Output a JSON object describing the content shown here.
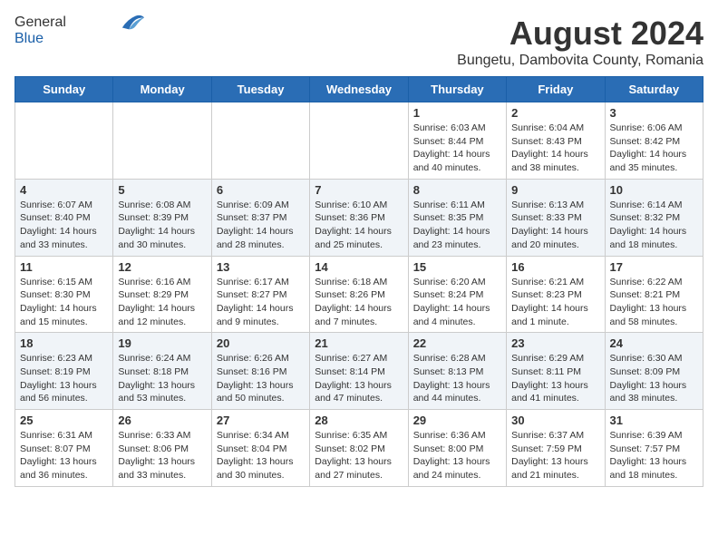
{
  "header": {
    "logo_general": "General",
    "logo_blue": "Blue",
    "month_title": "August 2024",
    "location": "Bungetu, Dambovita County, Romania"
  },
  "days_of_week": [
    "Sunday",
    "Monday",
    "Tuesday",
    "Wednesday",
    "Thursday",
    "Friday",
    "Saturday"
  ],
  "weeks": [
    [
      {
        "day": "",
        "info": ""
      },
      {
        "day": "",
        "info": ""
      },
      {
        "day": "",
        "info": ""
      },
      {
        "day": "",
        "info": ""
      },
      {
        "day": "1",
        "info": "Sunrise: 6:03 AM\nSunset: 8:44 PM\nDaylight: 14 hours\nand 40 minutes."
      },
      {
        "day": "2",
        "info": "Sunrise: 6:04 AM\nSunset: 8:43 PM\nDaylight: 14 hours\nand 38 minutes."
      },
      {
        "day": "3",
        "info": "Sunrise: 6:06 AM\nSunset: 8:42 PM\nDaylight: 14 hours\nand 35 minutes."
      }
    ],
    [
      {
        "day": "4",
        "info": "Sunrise: 6:07 AM\nSunset: 8:40 PM\nDaylight: 14 hours\nand 33 minutes."
      },
      {
        "day": "5",
        "info": "Sunrise: 6:08 AM\nSunset: 8:39 PM\nDaylight: 14 hours\nand 30 minutes."
      },
      {
        "day": "6",
        "info": "Sunrise: 6:09 AM\nSunset: 8:37 PM\nDaylight: 14 hours\nand 28 minutes."
      },
      {
        "day": "7",
        "info": "Sunrise: 6:10 AM\nSunset: 8:36 PM\nDaylight: 14 hours\nand 25 minutes."
      },
      {
        "day": "8",
        "info": "Sunrise: 6:11 AM\nSunset: 8:35 PM\nDaylight: 14 hours\nand 23 minutes."
      },
      {
        "day": "9",
        "info": "Sunrise: 6:13 AM\nSunset: 8:33 PM\nDaylight: 14 hours\nand 20 minutes."
      },
      {
        "day": "10",
        "info": "Sunrise: 6:14 AM\nSunset: 8:32 PM\nDaylight: 14 hours\nand 18 minutes."
      }
    ],
    [
      {
        "day": "11",
        "info": "Sunrise: 6:15 AM\nSunset: 8:30 PM\nDaylight: 14 hours\nand 15 minutes."
      },
      {
        "day": "12",
        "info": "Sunrise: 6:16 AM\nSunset: 8:29 PM\nDaylight: 14 hours\nand 12 minutes."
      },
      {
        "day": "13",
        "info": "Sunrise: 6:17 AM\nSunset: 8:27 PM\nDaylight: 14 hours\nand 9 minutes."
      },
      {
        "day": "14",
        "info": "Sunrise: 6:18 AM\nSunset: 8:26 PM\nDaylight: 14 hours\nand 7 minutes."
      },
      {
        "day": "15",
        "info": "Sunrise: 6:20 AM\nSunset: 8:24 PM\nDaylight: 14 hours\nand 4 minutes."
      },
      {
        "day": "16",
        "info": "Sunrise: 6:21 AM\nSunset: 8:23 PM\nDaylight: 14 hours\nand 1 minute."
      },
      {
        "day": "17",
        "info": "Sunrise: 6:22 AM\nSunset: 8:21 PM\nDaylight: 13 hours\nand 58 minutes."
      }
    ],
    [
      {
        "day": "18",
        "info": "Sunrise: 6:23 AM\nSunset: 8:19 PM\nDaylight: 13 hours\nand 56 minutes."
      },
      {
        "day": "19",
        "info": "Sunrise: 6:24 AM\nSunset: 8:18 PM\nDaylight: 13 hours\nand 53 minutes."
      },
      {
        "day": "20",
        "info": "Sunrise: 6:26 AM\nSunset: 8:16 PM\nDaylight: 13 hours\nand 50 minutes."
      },
      {
        "day": "21",
        "info": "Sunrise: 6:27 AM\nSunset: 8:14 PM\nDaylight: 13 hours\nand 47 minutes."
      },
      {
        "day": "22",
        "info": "Sunrise: 6:28 AM\nSunset: 8:13 PM\nDaylight: 13 hours\nand 44 minutes."
      },
      {
        "day": "23",
        "info": "Sunrise: 6:29 AM\nSunset: 8:11 PM\nDaylight: 13 hours\nand 41 minutes."
      },
      {
        "day": "24",
        "info": "Sunrise: 6:30 AM\nSunset: 8:09 PM\nDaylight: 13 hours\nand 38 minutes."
      }
    ],
    [
      {
        "day": "25",
        "info": "Sunrise: 6:31 AM\nSunset: 8:07 PM\nDaylight: 13 hours\nand 36 minutes."
      },
      {
        "day": "26",
        "info": "Sunrise: 6:33 AM\nSunset: 8:06 PM\nDaylight: 13 hours\nand 33 minutes."
      },
      {
        "day": "27",
        "info": "Sunrise: 6:34 AM\nSunset: 8:04 PM\nDaylight: 13 hours\nand 30 minutes."
      },
      {
        "day": "28",
        "info": "Sunrise: 6:35 AM\nSunset: 8:02 PM\nDaylight: 13 hours\nand 27 minutes."
      },
      {
        "day": "29",
        "info": "Sunrise: 6:36 AM\nSunset: 8:00 PM\nDaylight: 13 hours\nand 24 minutes."
      },
      {
        "day": "30",
        "info": "Sunrise: 6:37 AM\nSunset: 7:59 PM\nDaylight: 13 hours\nand 21 minutes."
      },
      {
        "day": "31",
        "info": "Sunrise: 6:39 AM\nSunset: 7:57 PM\nDaylight: 13 hours\nand 18 minutes."
      }
    ]
  ]
}
